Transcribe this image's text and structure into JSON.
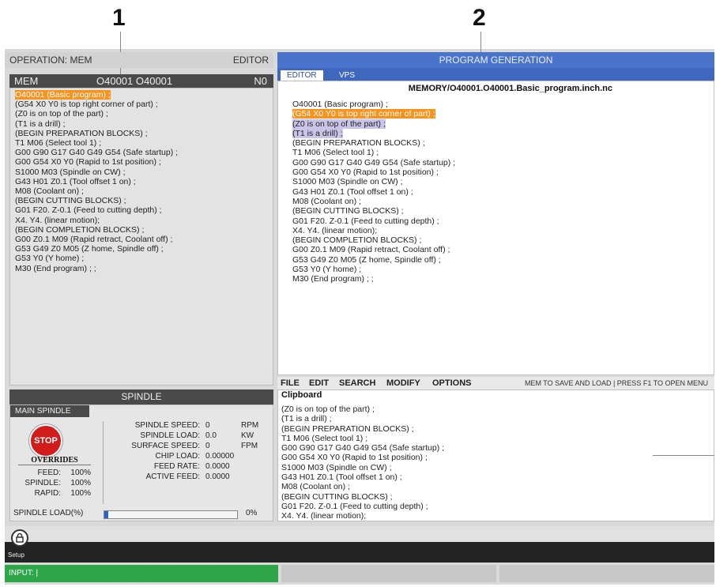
{
  "callouts": {
    "one": "1",
    "two": "2"
  },
  "left": {
    "operation_label": "OPERATION: MEM",
    "mode_label": "EDITOR",
    "mem_label": "MEM",
    "program_number": "O40001 O40001",
    "line_number": "N0",
    "code": [
      {
        "text": "O40001 (Basic program) ;",
        "hl": "orange"
      },
      {
        "text": "(G54 X0 Y0 is top right corner of part) ;"
      },
      {
        "text": "(Z0 is on top of the part) ;"
      },
      {
        "text": "(T1 is a drill) ;"
      },
      {
        "text": "(BEGIN PREPARATION BLOCKS) ;"
      },
      {
        "text": "T1 M06 (Select tool 1) ;"
      },
      {
        "text": "G00 G90 G17 G40 G49 G54 (Safe startup) ;"
      },
      {
        "text": "G00 G54 X0 Y0 (Rapid to 1st position) ;"
      },
      {
        "text": "S1000 M03 (Spindle on CW) ;"
      },
      {
        "text": "G43 H01 Z0.1 (Tool offset 1 on) ;"
      },
      {
        "text": "M08 (Coolant on) ;"
      },
      {
        "text": "(BEGIN CUTTING BLOCKS) ;"
      },
      {
        "text": "G01 F20. Z-0.1 (Feed to cutting depth) ;"
      },
      {
        "text": "X4. Y4. (linear motion);"
      },
      {
        "text": "(BEGIN COMPLETION BLOCKS) ;"
      },
      {
        "text": "G00 Z0.1 M09 (Rapid retract, Coolant off) ;"
      },
      {
        "text": "G53 G49 Z0 M05 (Z home, Spindle off) ;"
      },
      {
        "text": "G53 Y0 (Y home) ;"
      },
      {
        "text": "M30 (End program) ; ;"
      }
    ]
  },
  "spindle": {
    "title": "SPINDLE",
    "main_label": "MAIN SPINDLE",
    "stop_label": "STOP",
    "overrides_label": "OVERRIDES",
    "overrides": [
      {
        "label": "FEED:",
        "value": "100%"
      },
      {
        "label": "SPINDLE:",
        "value": "100%"
      },
      {
        "label": "RAPID:",
        "value": "100%"
      }
    ],
    "stats": [
      {
        "label": "SPINDLE SPEED:",
        "value": "0",
        "unit": "RPM"
      },
      {
        "label": "SPINDLE LOAD:",
        "value": "0.0",
        "unit": "KW"
      },
      {
        "label": "SURFACE SPEED:",
        "value": "0",
        "unit": "FPM"
      },
      {
        "label": "CHIP LOAD:",
        "value": "0.00000",
        "unit": ""
      },
      {
        "label": "FEED RATE:",
        "value": "0.0000",
        "unit": ""
      },
      {
        "label": "ACTIVE FEED:",
        "value": "0.0000",
        "unit": ""
      }
    ],
    "load_label": "SPINDLE LOAD(%)",
    "load_value": "0%",
    "load_fraction": 0.0
  },
  "right": {
    "header": "PROGRAM GENERATION",
    "tabs": [
      "EDITOR",
      "VPS"
    ],
    "file_path": "MEMORY/O40001.O40001.Basic_program.inch.nc",
    "code": [
      {
        "text": "O40001 (Basic program) ;"
      },
      {
        "text": "(G54 X0 Y0 is top right corner of part) ;",
        "hl": "orange"
      },
      {
        "text": "(Z0 is on top of the part) ;",
        "hl": "lavender"
      },
      {
        "text": "(T1 is a drill) ;",
        "hl": "lavender"
      },
      {
        "text": "(BEGIN PREPARATION BLOCKS) ;"
      },
      {
        "text": "T1 M06 (Select tool 1) ;"
      },
      {
        "text": "G00 G90 G17 G40 G49 G54 (Safe startup) ;"
      },
      {
        "text": "G00 G54 X0 Y0 (Rapid to 1st position) ;"
      },
      {
        "text": "S1000 M03 (Spindle on CW) ;"
      },
      {
        "text": "G43 H01 Z0.1 (Tool offset 1 on) ;"
      },
      {
        "text": "M08 (Coolant on) ;"
      },
      {
        "text": "(BEGIN CUTTING BLOCKS) ;"
      },
      {
        "text": "G01 F20. Z-0.1 (Feed to cutting depth) ;"
      },
      {
        "text": "X4. Y4. (linear motion);"
      },
      {
        "text": "(BEGIN COMPLETION BLOCKS) ;"
      },
      {
        "text": "G00 Z0.1 M09 (Rapid retract, Coolant off) ;"
      },
      {
        "text": "G53 G49 Z0 M05 (Z home, Spindle off) ;"
      },
      {
        "text": "G53 Y0 (Y home) ;"
      },
      {
        "text": "M30 (End program) ; ;"
      }
    ],
    "menu": [
      "FILE",
      "EDIT",
      "SEARCH",
      "MODIFY",
      "OPTIONS"
    ],
    "menu_hint": "MEM TO SAVE AND LOAD | PRESS F1 TO OPEN MENU",
    "clipboard_label": "Clipboard",
    "clipboard": [
      "(Z0 is on top of the part) ;",
      "(T1 is a drill) ;",
      "(BEGIN PREPARATION BLOCKS) ;",
      "T1 M06 (Select tool 1) ;",
      "G00 G90 G17 G40 G49 G54 (Safe startup) ;",
      "G00 G54 X0 Y0 (Rapid to 1st position) ;",
      "S1000 M03 (Spindle on CW) ;",
      "G43 H01 Z0.1 (Tool offset 1 on) ;",
      "M08 (Coolant on) ;",
      "(BEGIN CUTTING BLOCKS) ;",
      "G01 F20. Z-0.1 (Feed to cutting depth) ;",
      "X4. Y4. (linear motion);"
    ]
  },
  "bottom": {
    "setup_label": "Setup",
    "input_label": "INPUT: |"
  },
  "colors": {
    "accent_blue": "#4a74c9",
    "highlight_orange": "#f7931e",
    "input_green": "#2ea64a"
  }
}
